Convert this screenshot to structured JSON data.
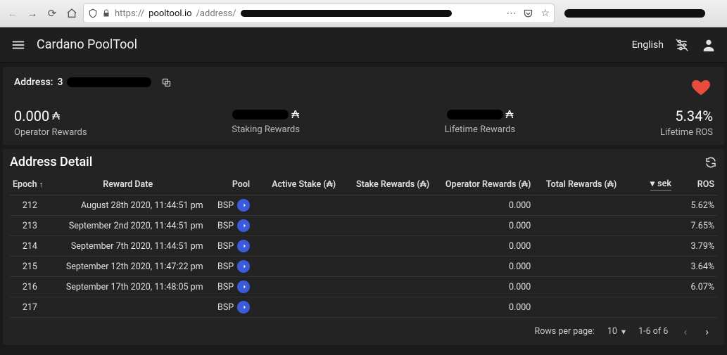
{
  "browser": {
    "url_scheme": "https://",
    "url_host": "pooltool.io",
    "url_path_prefix": "/address/"
  },
  "header": {
    "title": "Cardano PoolTool",
    "language": "English"
  },
  "address_card": {
    "label": "Address:",
    "address_prefix": "3",
    "stats": {
      "operator_rewards_value": "0.000",
      "operator_rewards_label": "Operator Rewards",
      "staking_rewards_label": "Staking Rewards",
      "lifetime_rewards_label": "Lifetime Rewards",
      "lifetime_ros_value": "5.34%",
      "lifetime_ros_label": "Lifetime ROS"
    }
  },
  "detail": {
    "title": "Address Detail",
    "columns": {
      "epoch": "Epoch",
      "reward_date": "Reward Date",
      "pool": "Pool",
      "active_stake": "Active Stake (₳)",
      "stake_rewards": "Stake Rewards (₳)",
      "operator_rewards": "Operator Rewards (₳)",
      "total_rewards": "Total Rewards (₳)",
      "currency": "sek",
      "ros": "ROS"
    },
    "rows": [
      {
        "epoch": "212",
        "date": "August 28th 2020, 11:44:51 pm",
        "pool": "BSP",
        "operator_rewards": "0.000",
        "ros": "5.62%"
      },
      {
        "epoch": "213",
        "date": "September 2nd 2020, 11:44:51 pm",
        "pool": "BSP",
        "operator_rewards": "0.000",
        "ros": "7.65%"
      },
      {
        "epoch": "214",
        "date": "September 7th 2020, 11:44:51 pm",
        "pool": "BSP",
        "operator_rewards": "0.000",
        "ros": "3.79%"
      },
      {
        "epoch": "215",
        "date": "September 12th 2020, 11:47:22 pm",
        "pool": "BSP",
        "operator_rewards": "0.000",
        "ros": "3.64%"
      },
      {
        "epoch": "216",
        "date": "September 17th 2020, 11:48:05 pm",
        "pool": "BSP",
        "operator_rewards": "0.000",
        "ros": "6.07%"
      },
      {
        "epoch": "217",
        "date": "",
        "pool": "BSP",
        "operator_rewards": "0.000",
        "ros": ""
      }
    ],
    "pagination": {
      "rows_per_page_label": "Rows per page:",
      "rows_per_page_value": "10",
      "range": "1-6 of 6"
    }
  }
}
